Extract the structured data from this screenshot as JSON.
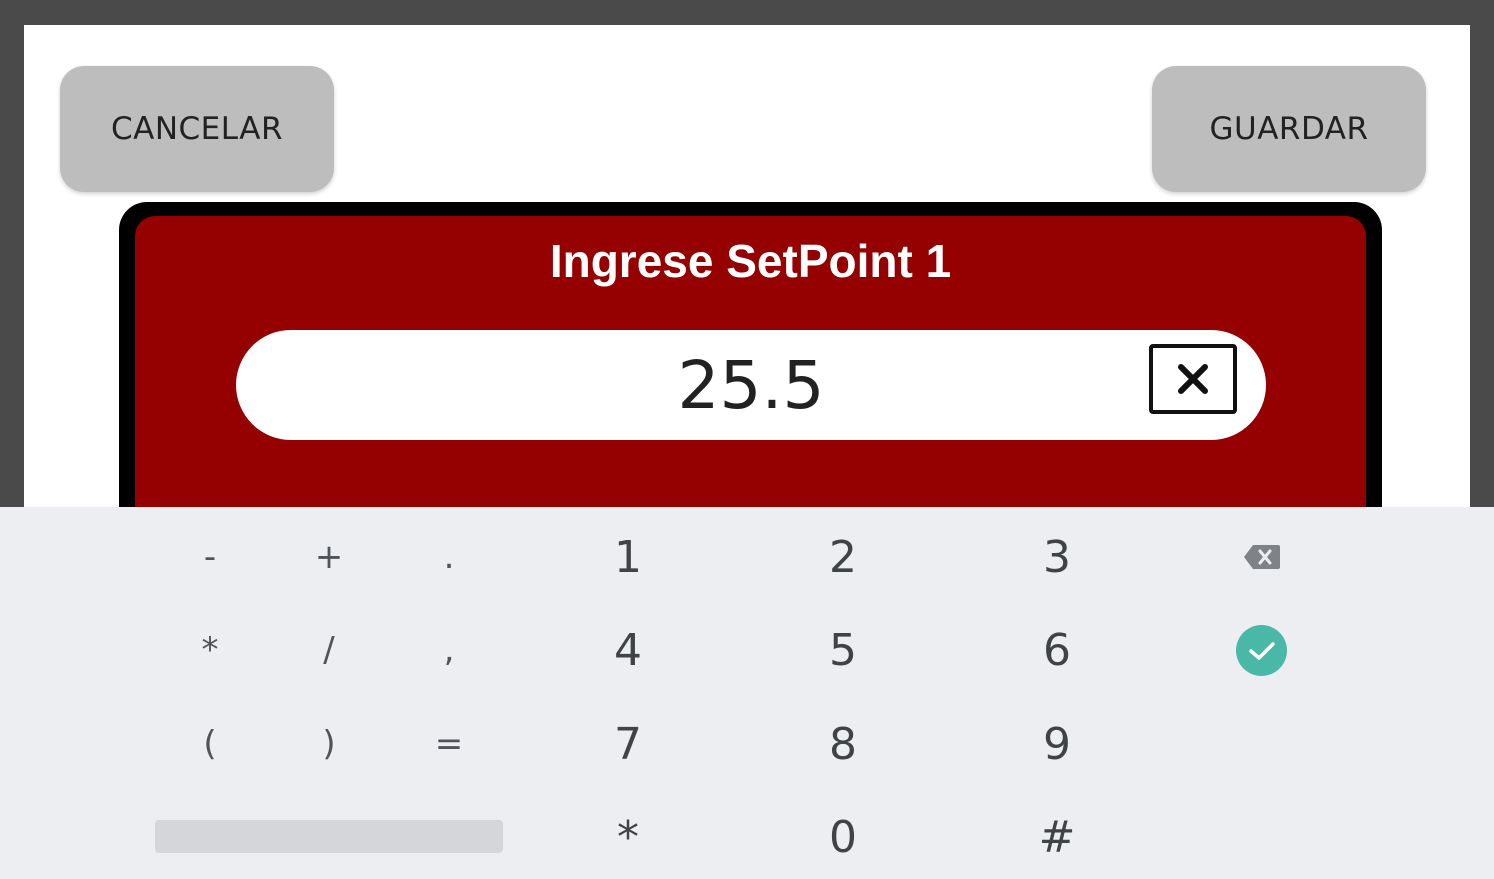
{
  "header": {
    "cancel_label": "CANCELAR",
    "save_label": "GUARDAR"
  },
  "dialog": {
    "title": "Ingrese SetPoint 1",
    "value": "25.5",
    "clear_icon": "close-box-icon"
  },
  "keyboard": {
    "row1": [
      "-",
      "+",
      ".",
      "1",
      "2",
      "3"
    ],
    "row2": [
      "*",
      "/",
      ",",
      "4",
      "5",
      "6"
    ],
    "row3": [
      "(",
      ")",
      "=",
      "7",
      "8",
      "9"
    ],
    "row4": [
      "*",
      "0",
      "#"
    ],
    "backspace_icon": "backspace-icon",
    "done_icon": "check-icon"
  },
  "colors": {
    "panel_red": "#950000",
    "done_teal": "#4ab8a6",
    "button_gray": "#bdbdbd",
    "keyboard_bg": "#eceef1"
  }
}
